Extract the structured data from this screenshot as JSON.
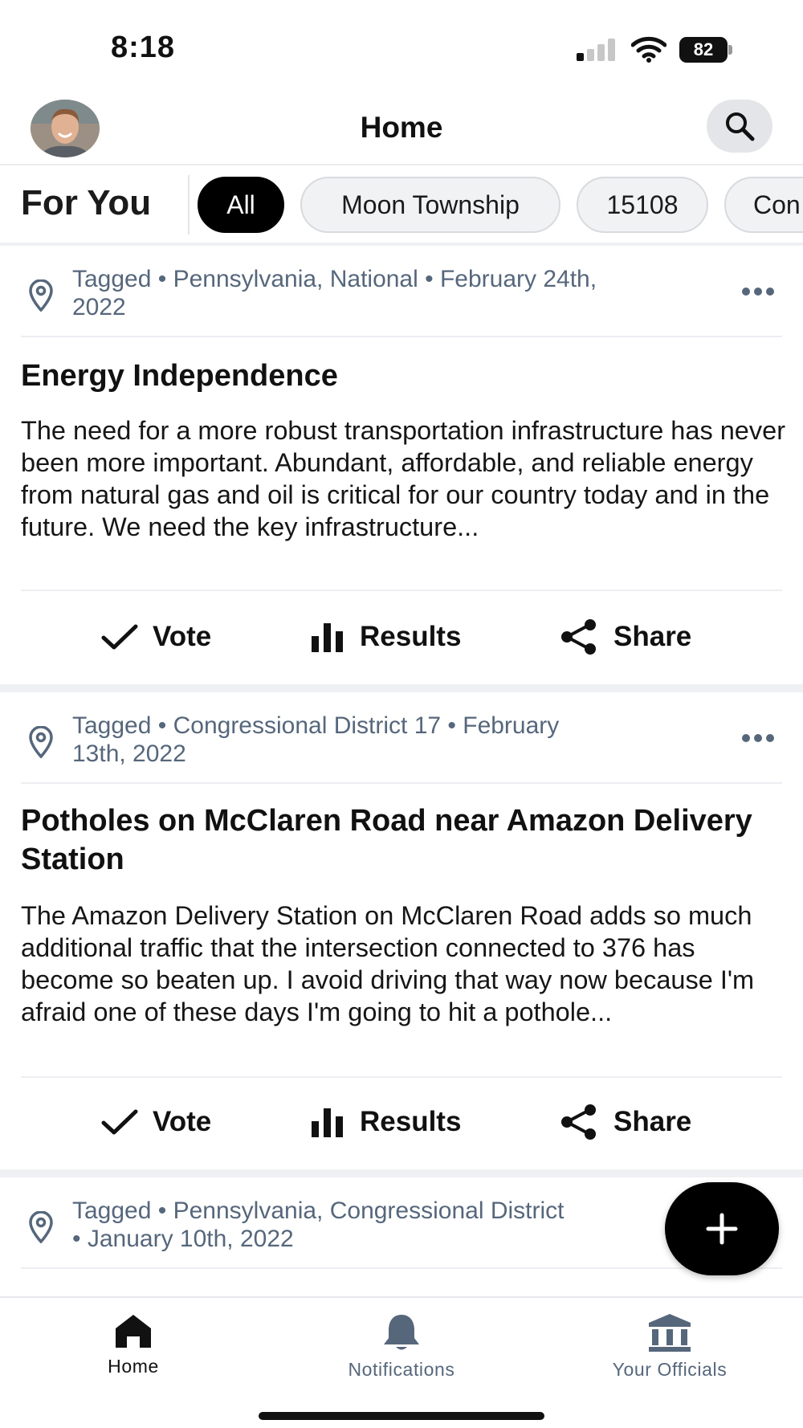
{
  "status_bar": {
    "time": "8:18",
    "battery": "82"
  },
  "header": {
    "title": "Home"
  },
  "filters": {
    "section_label": "For You",
    "chips": [
      "All",
      "Moon Township",
      "15108",
      "Con"
    ]
  },
  "posts": [
    {
      "meta_line1": "Tagged • Pennsylvania, National • February 24th,",
      "meta_line2": "2022",
      "title": "Energy Independence",
      "body": "The need for a more robust transportation infrastructure has never been more important. Abundant, affordable, and reliable energy from natural gas and oil is critical for our country today and in the future. We need the key infrastructure...",
      "actions": {
        "vote": "Vote",
        "results": "Results",
        "share": "Share"
      }
    },
    {
      "meta_line1": "Tagged • Congressional District 17 • February",
      "meta_line2": "13th, 2022",
      "title": "Potholes on McClaren Road near Amazon Delivery Station",
      "body": "The Amazon Delivery Station on McClaren Road adds so much additional traffic that the intersection connected to 376 has become so beaten up. I avoid driving that way now because I'm afraid one of these days I'm going to hit a pothole...",
      "actions": {
        "vote": "Vote",
        "results": "Results",
        "share": "Share"
      }
    },
    {
      "meta_line1": "Tagged • Pennsylvania, Congressional District",
      "meta_line2": "• January 10th, 2022"
    }
  ],
  "tabs": [
    {
      "label": "Home",
      "color": "#111111"
    },
    {
      "label": "Notifications",
      "color": "#56677c"
    },
    {
      "label": "Your Officials",
      "color": "#56677c"
    }
  ],
  "colors": {
    "accent": "#000000",
    "meta_text": "#56677c",
    "chip_bg": "#f1f2f4",
    "separator": "#eef0f3"
  }
}
